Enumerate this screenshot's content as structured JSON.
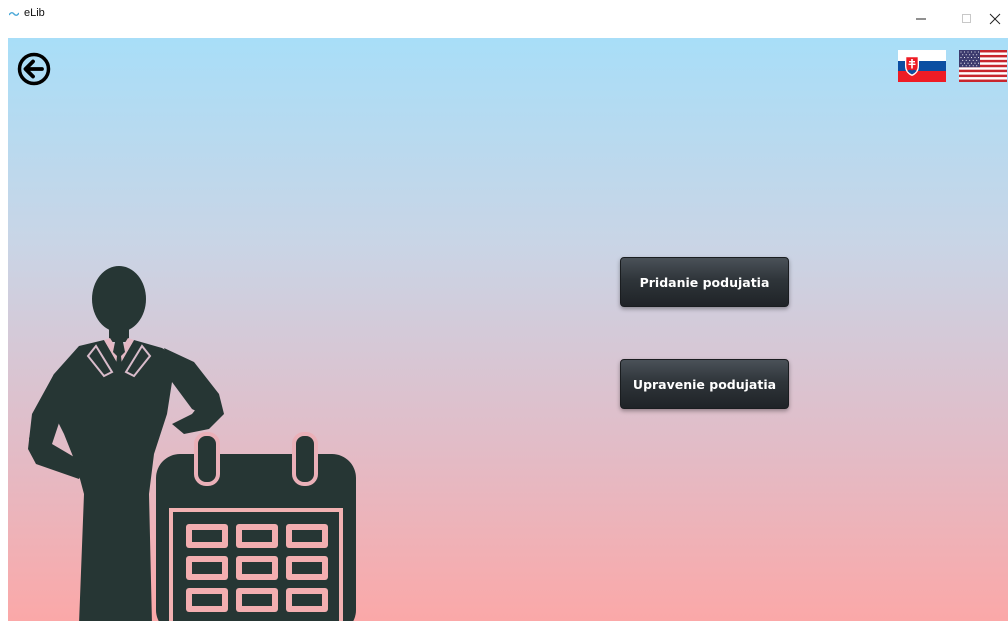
{
  "window": {
    "title": "eLib",
    "controls": {
      "minimize": "minimize",
      "maximize": "maximize",
      "close": "close"
    }
  },
  "toolbar": {
    "back_icon": "arrow-left-circle-icon"
  },
  "languages": [
    {
      "code": "sk",
      "icon": "slovakia-flag-icon"
    },
    {
      "code": "en",
      "icon": "usa-flag-icon"
    }
  ],
  "main": {
    "add_event_label": "Pridanie podujatia",
    "edit_event_label": "Upravenie podujatia"
  },
  "illustration": {
    "icon": "businessman-calendar-icon"
  },
  "colors": {
    "gradient_top": "#a8def8",
    "gradient_bottom": "#fba8a8",
    "button_dark": "#2f353a",
    "illustration": "#263634"
  }
}
